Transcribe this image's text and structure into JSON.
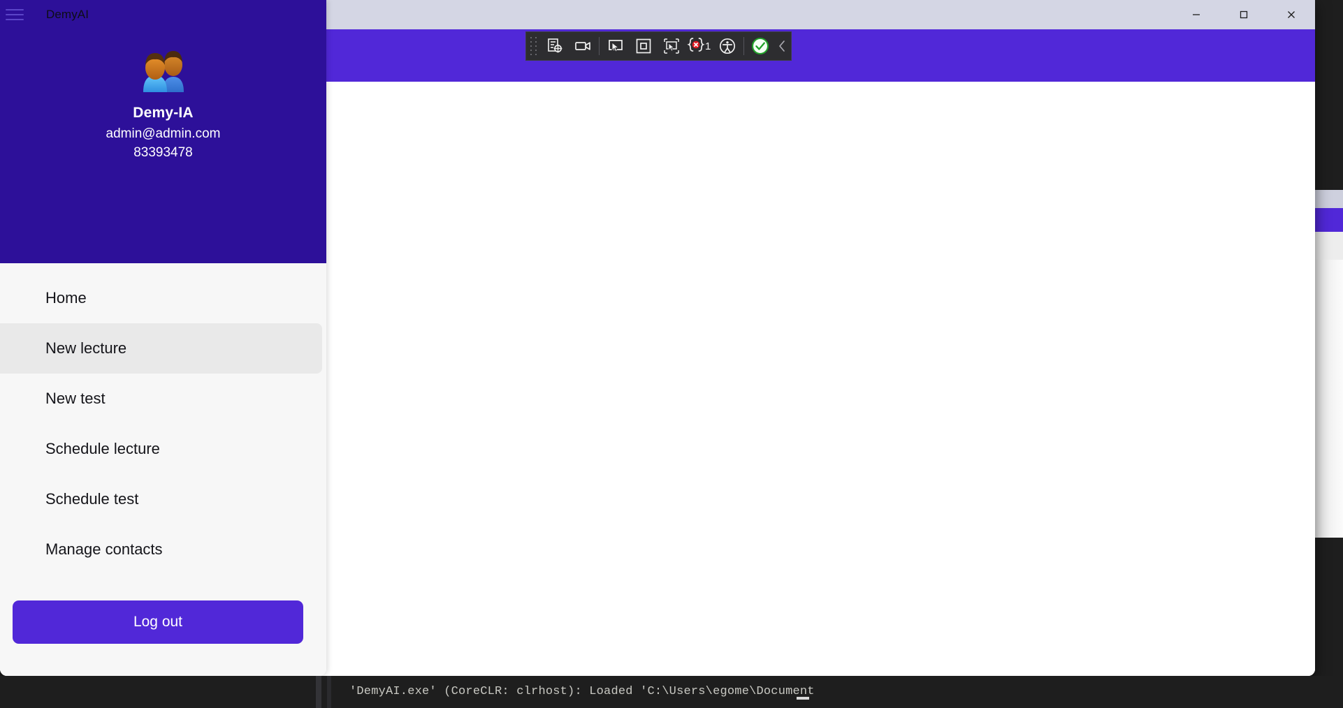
{
  "window": {
    "controls": [
      {
        "name": "minimize",
        "icon": "minimize-icon",
        "label": "Minimize"
      },
      {
        "name": "maximize",
        "icon": "maximize-icon",
        "label": "Maximize"
      },
      {
        "name": "close",
        "icon": "close-icon",
        "label": "Close"
      }
    ]
  },
  "sidebar": {
    "app_title": "DemyAI",
    "menu_icon": "hamburger-icon",
    "avatar_icon": "users-avatar-icon",
    "profile": {
      "name": "Demy-IA",
      "email": "admin@admin.com",
      "phone": "83393478"
    },
    "nav": [
      {
        "label": "Home",
        "active": false
      },
      {
        "label": "New lecture",
        "active": true
      },
      {
        "label": "New test",
        "active": false
      },
      {
        "label": "Schedule lecture",
        "active": false
      },
      {
        "label": "Schedule test",
        "active": false
      },
      {
        "label": "Manage contacts",
        "active": false
      }
    ],
    "logout_label": "Log out"
  },
  "toolbar": {
    "grip": "drag-grip-handle",
    "buttons": [
      {
        "name": "select-element-icon",
        "label": "Select Element"
      },
      {
        "name": "record-video-icon",
        "label": "Record"
      },
      {
        "name": "pointer-screen-icon",
        "label": "Live Visual Tree"
      },
      {
        "name": "layout-box-icon",
        "label": "Layout Adorner"
      },
      {
        "name": "pointer-capture-icon",
        "label": "Track Focused Element"
      },
      {
        "name": "accessibility-icon",
        "label": "Accessibility Checker"
      },
      {
        "name": "success-check-icon",
        "label": "Diagnostics OK"
      }
    ],
    "error_badge": {
      "icon": "error-braces-icon",
      "count": "1"
    },
    "collapse_icon": "chevron-left-icon"
  },
  "debug_output": {
    "line": "'DemyAI.exe' (CoreCLR: clrhost): Loaded 'C:\\Users\\egome\\Document"
  },
  "colors": {
    "sidebar_header": "#2d1099",
    "accent_purple": "#5128d8",
    "titlebar": "#d4d6e4",
    "sidebar_body": "#f7f7f7",
    "nav_active": "#e9e9e9",
    "toolbar_bg": "#2d2d30",
    "debug_bg": "#1e1e1e"
  }
}
